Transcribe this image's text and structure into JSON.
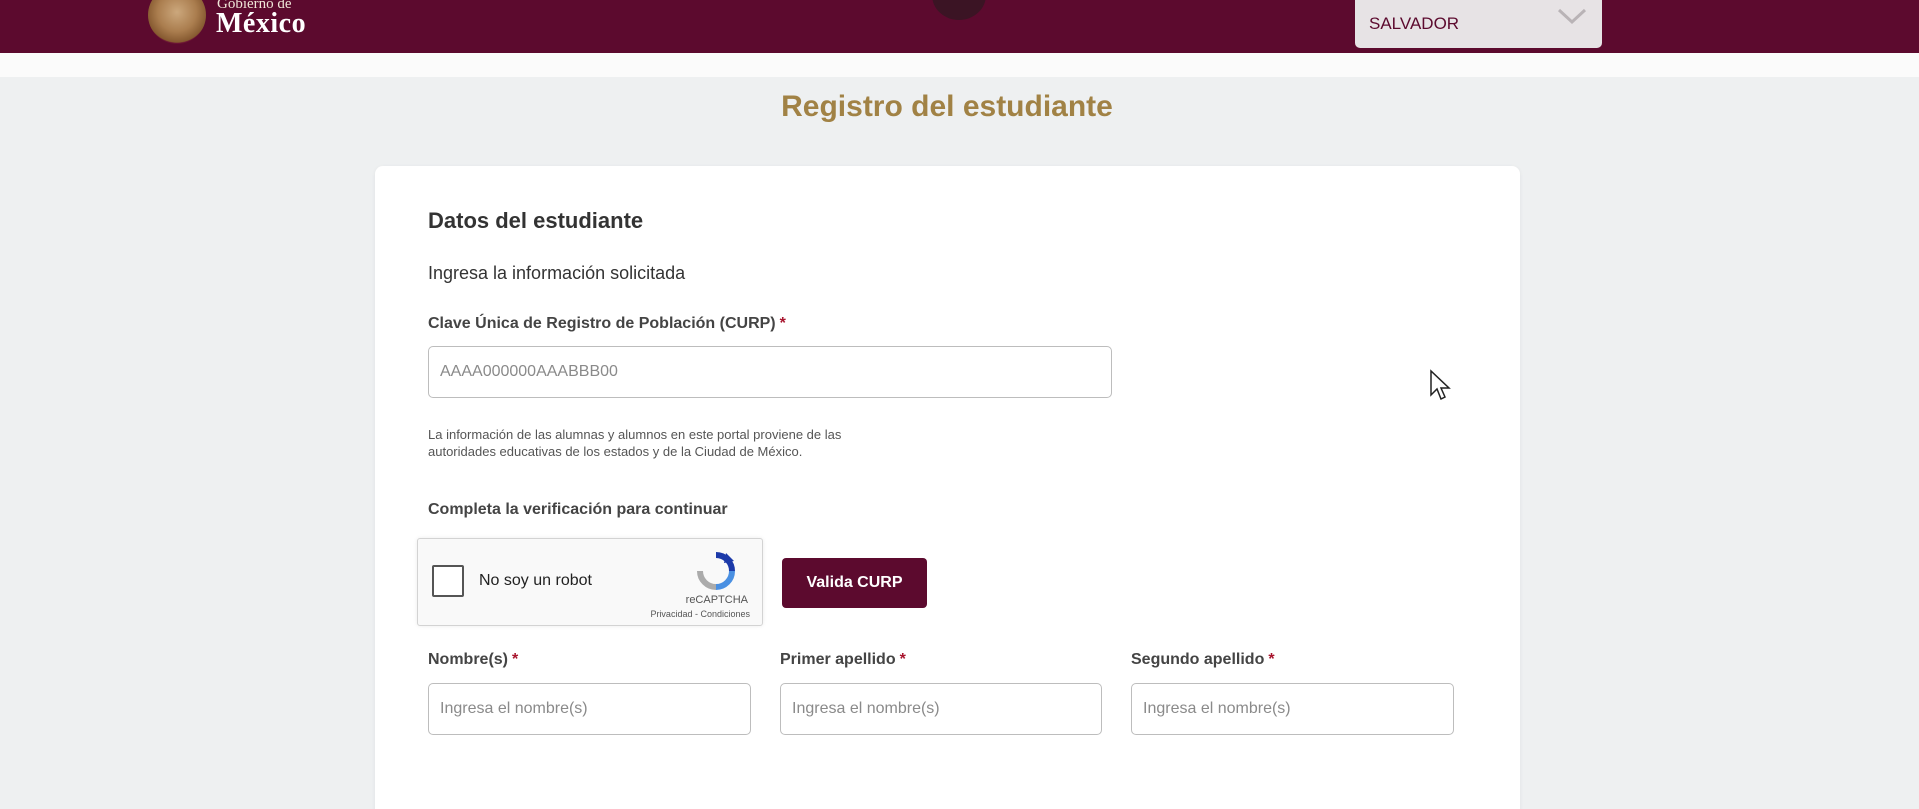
{
  "header": {
    "logo_line1": "Gobierno de",
    "logo_line2": "México",
    "selector_value": "SALVADOR",
    "bg_color": "#5c0a2e"
  },
  "page": {
    "title": "Registro del estudiante"
  },
  "form": {
    "section_title": "Datos del estudiante",
    "subtitle": "Ingresa la información solicitada",
    "curp_label": "Clave Única de Registro de Población (CURP)",
    "required_mark": "*",
    "curp_placeholder": "AAAA000000AAABBB00",
    "curp_value": "",
    "note": "La información de las alumnas y alumnos en este portal proviene de las autoridades educativas de los estados y de la Ciudad de México.",
    "verify_label": "Completa la verificación para continuar",
    "captcha": {
      "text": "No soy un robot",
      "brand": "reCAPTCHA",
      "links": "Privacidad - Condiciones"
    },
    "validate_button": "Valida CURP",
    "fields": [
      {
        "label": "Nombre(s)",
        "placeholder": "Ingresa el nombre(s)",
        "value": ""
      },
      {
        "label": "Primer apellido",
        "placeholder": "Ingresa el nombre(s)",
        "value": ""
      },
      {
        "label": "Segundo apellido",
        "placeholder": "Ingresa el nombre(s)",
        "value": ""
      }
    ]
  }
}
